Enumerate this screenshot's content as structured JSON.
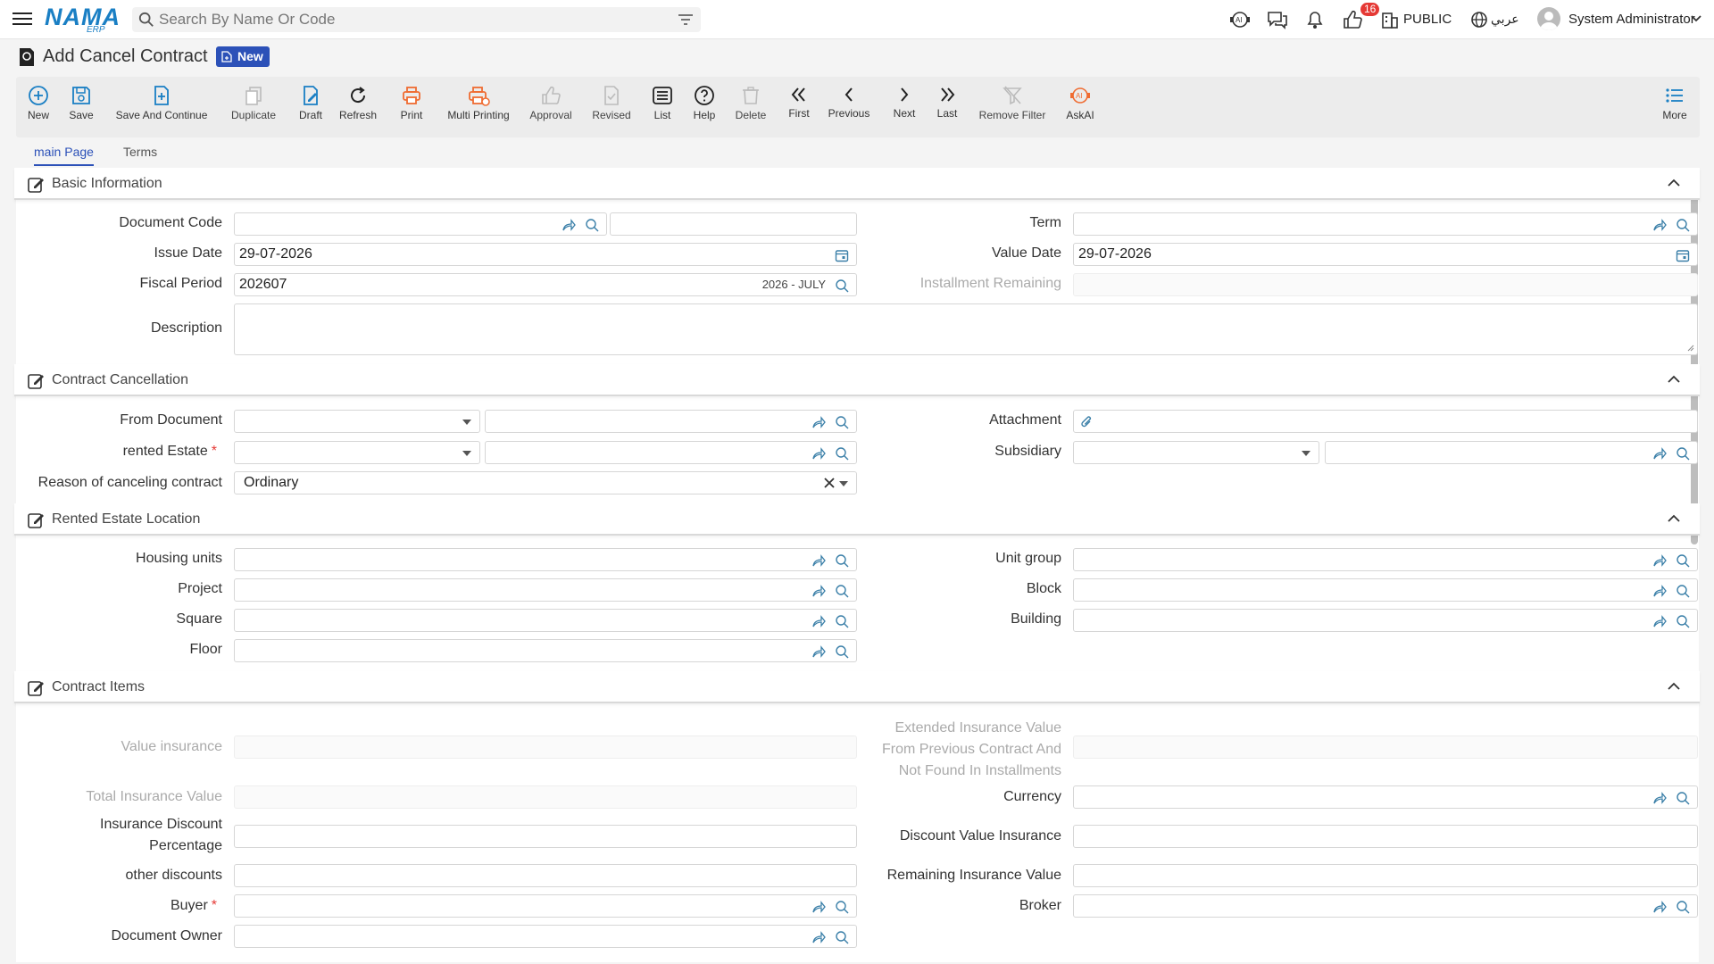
{
  "header": {
    "logo": "NAMA",
    "logo_sub": "ERP",
    "search_placeholder": "Search By Name Or Code",
    "notification_count": "16",
    "public_label": "PUBLIC",
    "language": "عربي",
    "user": "System Administrator"
  },
  "page": {
    "title": "Add Cancel Contract",
    "status_badge": "New"
  },
  "toolbar": {
    "items": [
      {
        "label": "New",
        "icon": "plus-circle-icon",
        "color": "#1a7fc4"
      },
      {
        "label": "Save",
        "icon": "save-icon",
        "color": "#1a7fc4"
      },
      {
        "label": "Save And Continue",
        "icon": "file-plus-icon",
        "color": "#1a7fc4"
      },
      {
        "label": "Duplicate",
        "icon": "copy-icon",
        "color": "#bbbbbb"
      },
      {
        "label": "Draft",
        "icon": "draft-icon",
        "color": "#1a7fc4"
      },
      {
        "label": "Refresh",
        "icon": "refresh-icon",
        "color": "#222222"
      },
      {
        "label": "Print",
        "icon": "print-icon",
        "color": "#ef6c32"
      },
      {
        "label": "Multi Printing",
        "icon": "multi-print-icon",
        "color": "#ef6c32"
      },
      {
        "label": "Approval",
        "icon": "thumbs-up-icon",
        "color": "#bbbbbb"
      },
      {
        "label": "Revised",
        "icon": "revised-icon",
        "color": "#bbbbbb"
      },
      {
        "label": "List",
        "icon": "list-icon",
        "color": "#222222"
      },
      {
        "label": "Help",
        "icon": "help-icon",
        "color": "#222222"
      },
      {
        "label": "Delete",
        "icon": "trash-icon",
        "color": "#bbbbbb"
      },
      {
        "label": "First",
        "icon": "double-chevron-left-icon",
        "color": "#222222"
      },
      {
        "label": "Previous",
        "icon": "chevron-left-icon",
        "color": "#222222"
      },
      {
        "label": "Next",
        "icon": "chevron-right-icon",
        "color": "#222222"
      },
      {
        "label": "Last",
        "icon": "double-chevron-right-icon",
        "color": "#222222"
      },
      {
        "label": "Remove Filter",
        "icon": "remove-filter-icon",
        "color": "#bbbbbb"
      },
      {
        "label": "AskAI",
        "icon": "ai-icon",
        "color": "#ef6c32"
      },
      {
        "label": "More",
        "icon": "more-list-icon",
        "color": "#1a7fc4"
      }
    ]
  },
  "tabs": [
    "main Page",
    "Terms"
  ],
  "sections": {
    "basic": "Basic Information",
    "cancellation": "Contract Cancellation",
    "location": "Rented Estate Location",
    "items": "Contract Items"
  },
  "fields": {
    "document_code": {
      "label": "Document Code",
      "value": ""
    },
    "term": {
      "label": "Term",
      "value": ""
    },
    "issue_date": {
      "label": "Issue Date",
      "value": "29-07-2026"
    },
    "value_date": {
      "label": "Value Date",
      "value": "29-07-2026"
    },
    "fiscal_period": {
      "label": "Fiscal Period",
      "value": "202607",
      "period_name": "2026 - JULY"
    },
    "installment_remaining": {
      "label": "Installment Remaining",
      "value": ""
    },
    "description": {
      "label": "Description",
      "value": ""
    },
    "from_document": {
      "label": "From Document",
      "value": ""
    },
    "attachment": {
      "label": "Attachment",
      "value": ""
    },
    "rented_estate": {
      "label": "rented Estate",
      "value": ""
    },
    "subsidiary": {
      "label": "Subsidiary",
      "value": ""
    },
    "reason": {
      "label": "Reason of canceling contract",
      "value": "Ordinary"
    },
    "housing_units": {
      "label": "Housing units",
      "value": ""
    },
    "unit_group": {
      "label": "Unit group",
      "value": ""
    },
    "project": {
      "label": "Project",
      "value": ""
    },
    "block": {
      "label": "Block",
      "value": ""
    },
    "square": {
      "label": "Square",
      "value": ""
    },
    "building": {
      "label": "Building",
      "value": ""
    },
    "floor": {
      "label": "Floor",
      "value": ""
    },
    "value_insurance": {
      "label": "Value insurance",
      "value": ""
    },
    "extended_insurance": {
      "label_lines": [
        "Extended Insurance Value",
        "From Previous Contract And",
        "Not Found In Installments"
      ],
      "value": ""
    },
    "total_insurance": {
      "label": "Total Insurance Value",
      "value": ""
    },
    "currency": {
      "label": "Currency",
      "value": ""
    },
    "insurance_discount_pct": {
      "label_lines": [
        "Insurance Discount",
        "Percentage"
      ],
      "value": ""
    },
    "discount_value_insurance": {
      "label": "Discount Value Insurance",
      "value": ""
    },
    "other_discounts": {
      "label": "other discounts",
      "value": ""
    },
    "remaining_insurance": {
      "label": "Remaining Insurance Value",
      "value": ""
    },
    "buyer": {
      "label": "Buyer",
      "value": ""
    },
    "broker": {
      "label": "Broker",
      "value": ""
    },
    "document_owner": {
      "label": "Document Owner",
      "value": ""
    }
  }
}
